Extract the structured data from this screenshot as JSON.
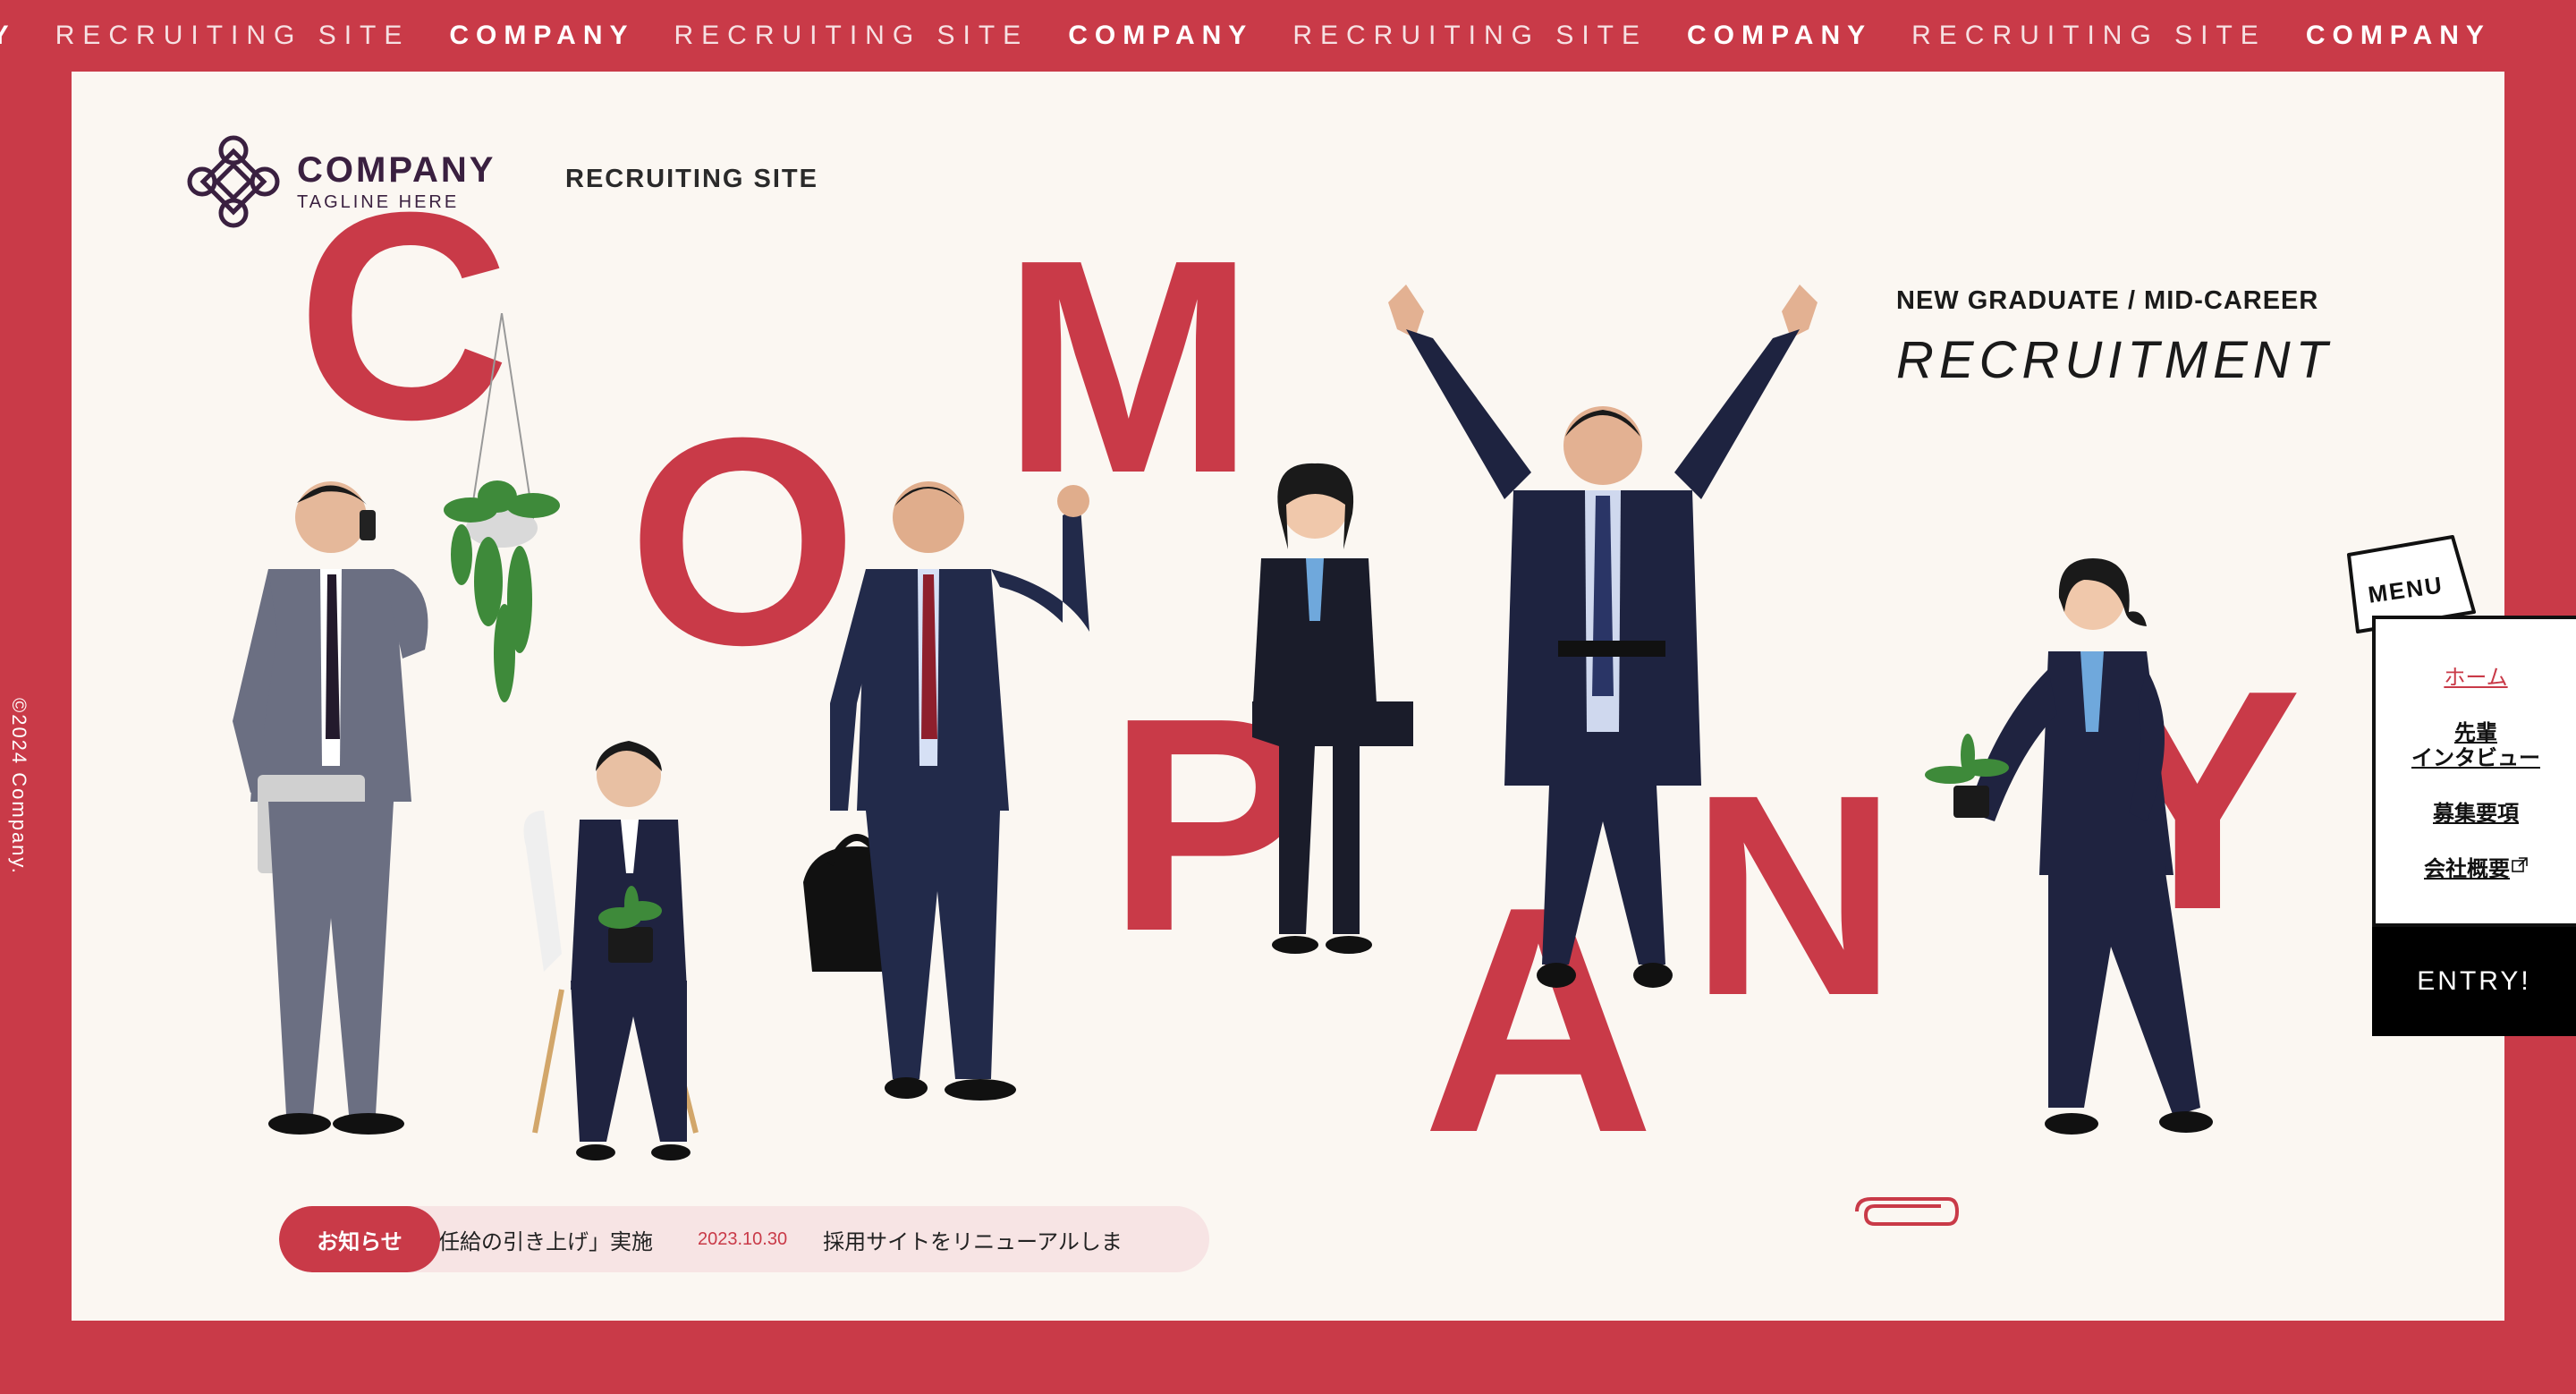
{
  "marquee": [
    {
      "text": "NY",
      "style": "bold"
    },
    {
      "text": "RECRUITING SITE",
      "style": "thin"
    },
    {
      "text": "COMPANY",
      "style": "bold"
    },
    {
      "text": "RECRUITING SITE",
      "style": "thin"
    },
    {
      "text": "COMPANY",
      "style": "bold"
    },
    {
      "text": "RECRUITING SITE",
      "style": "thin"
    },
    {
      "text": "COMPANY",
      "style": "bold"
    },
    {
      "text": "RECRUITING SITE",
      "style": "thin"
    },
    {
      "text": "COMPANY",
      "style": "bold"
    }
  ],
  "copyright": "©2024 Company.",
  "header": {
    "logo_name": "COMPANY",
    "logo_tagline": "TAGLINE HERE",
    "site_label": "RECRUITING SITE",
    "recruit_sub": "NEW GRADUATE / MID-CAREER",
    "recruit_main": "RECRUITMENT"
  },
  "hero": {
    "letters": [
      "C",
      "O",
      "M",
      "P",
      "A",
      "N",
      "Y"
    ]
  },
  "news": {
    "label": "お知らせ",
    "items": [
      {
        "date": "",
        "title": "任給の引き上げ」実施"
      },
      {
        "date": "2023.10.30",
        "title": "採用サイトをリニューアルしま"
      }
    ]
  },
  "menu": {
    "bubble_label": "MENU",
    "items": [
      "ホーム",
      "先輩\nインタビュー",
      "募集要項",
      "会社概要"
    ],
    "entry": "ENTRY!"
  },
  "colors": {
    "brand_red": "#c93a48",
    "background": "#fbf7f2",
    "logo_purple": "#3a2040"
  },
  "icons": [
    "company-logo-icon",
    "external-link-icon",
    "paperclip-icon",
    "plant-icon"
  ]
}
